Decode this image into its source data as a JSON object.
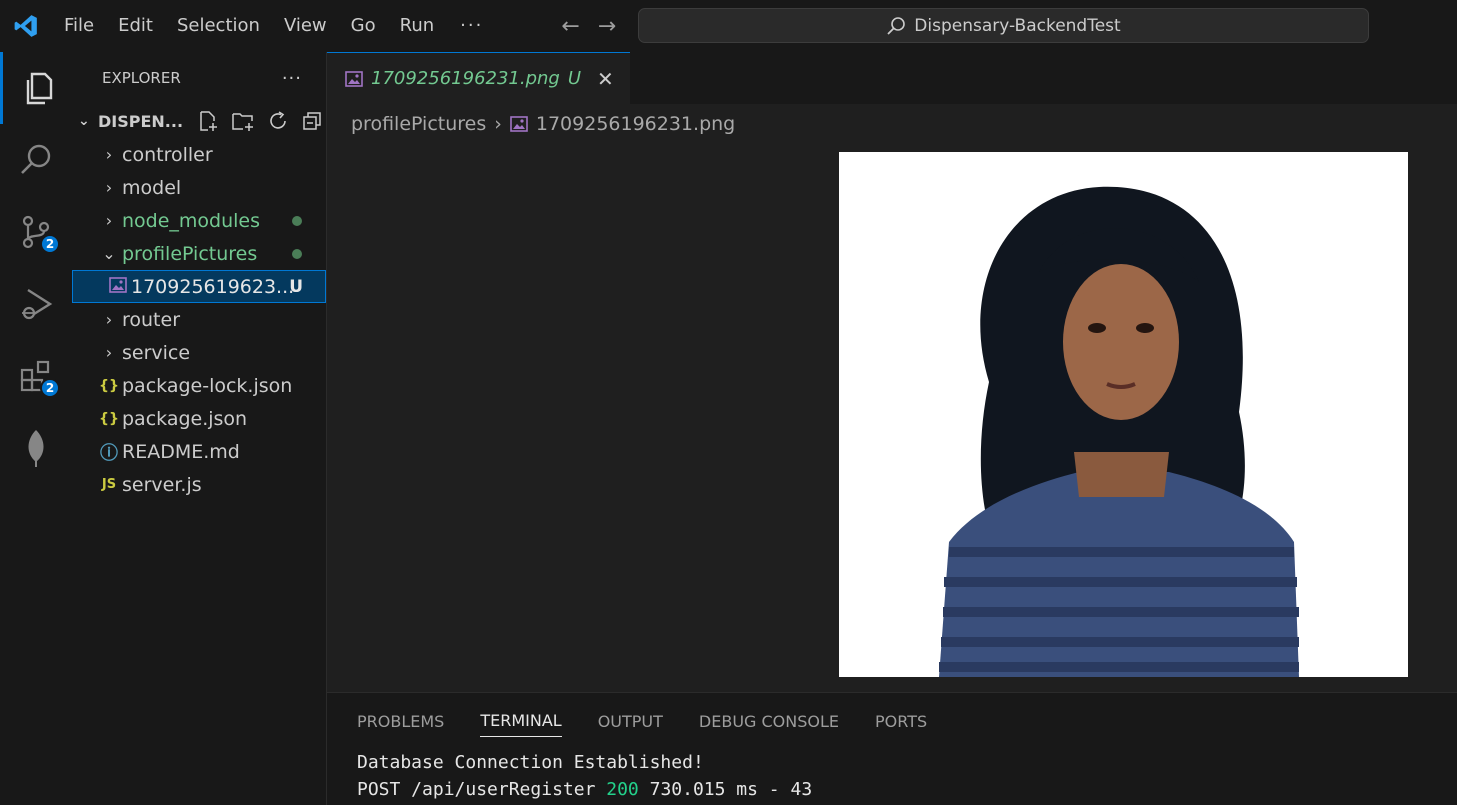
{
  "menu": [
    "File",
    "Edit",
    "Selection",
    "View",
    "Go",
    "Run"
  ],
  "menu_more": "···",
  "command_center": {
    "label": "Dispensary-BackendTest"
  },
  "activity": {
    "source_control_badge": "2",
    "extensions_badge": "2"
  },
  "explorer": {
    "title": "EXPLORER",
    "more": "···",
    "folder_name": "DISPEN...",
    "items": [
      {
        "label": "controller",
        "type": "folder"
      },
      {
        "label": "model",
        "type": "folder"
      },
      {
        "label": "node_modules",
        "type": "folder"
      },
      {
        "label": "profilePictures",
        "type": "folder-open"
      },
      {
        "label": "170925619623...",
        "type": "image",
        "status": "U"
      },
      {
        "label": "router",
        "type": "folder"
      },
      {
        "label": "service",
        "type": "folder"
      },
      {
        "label": "package-lock.json",
        "type": "json",
        "icon": "{}"
      },
      {
        "label": "package.json",
        "type": "json",
        "icon": "{}"
      },
      {
        "label": "README.md",
        "type": "info",
        "icon": "ⓘ"
      },
      {
        "label": "server.js",
        "type": "js",
        "icon": "JS"
      }
    ]
  },
  "editor": {
    "tab_label": "1709256196231.png",
    "tab_status": "U",
    "breadcrumb_folder": "profilePictures",
    "breadcrumb_file": "1709256196231.png"
  },
  "panel": {
    "tabs": [
      "PROBLEMS",
      "TERMINAL",
      "OUTPUT",
      "DEBUG CONSOLE",
      "PORTS"
    ],
    "terminal_line1": "Database Connection Established!",
    "terminal_line2_pre": "POST /api/userRegister ",
    "terminal_line2_status": "200",
    "terminal_line2_post": " 730.015 ms - 43"
  },
  "colors": {
    "accent": "#0078d4",
    "git_untracked": "#73c991"
  }
}
